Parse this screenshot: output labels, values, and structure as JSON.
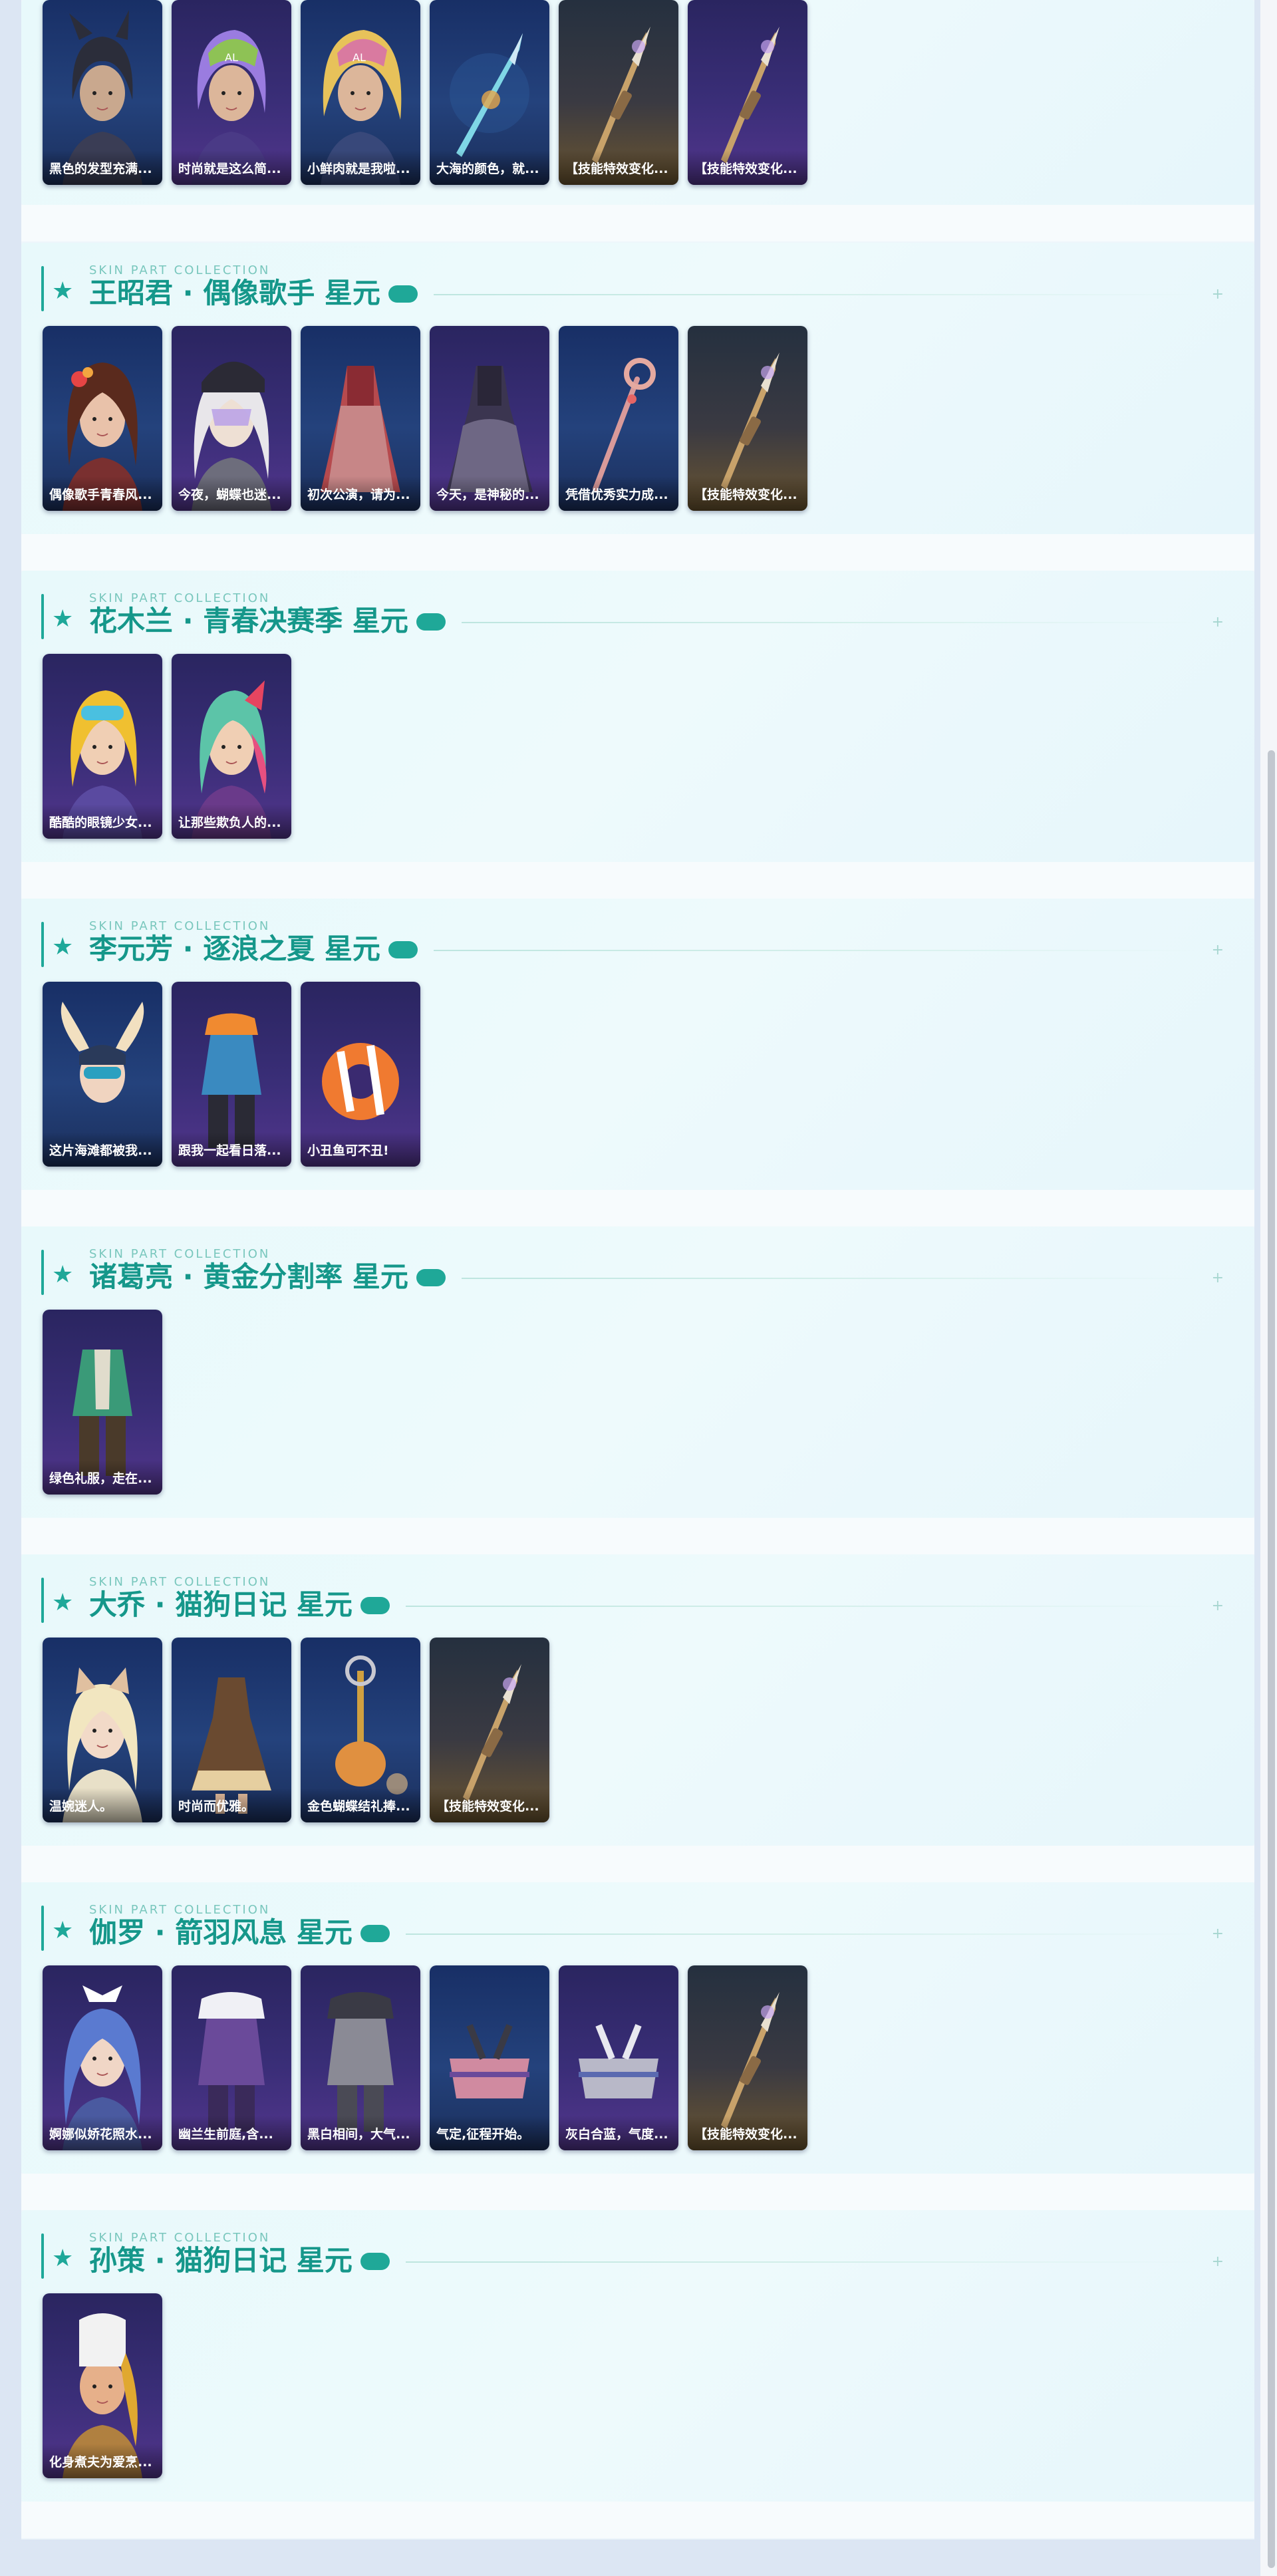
{
  "colors": {
    "accent": "#1ea899",
    "page_bg": "#dce6f3",
    "section_bg": "#e8f9fb",
    "card_blue": "#1f3a75",
    "card_purple": "#34296e",
    "card_gold": "#6b5530"
  },
  "top_row": {
    "items": [
      {
        "caption": "黑色的发型充满...",
        "tone": "blue",
        "icon": "hair-dark-icon"
      },
      {
        "caption": "时尚就是这么简...",
        "tone": "purple",
        "icon": "hair-purple-cap-icon"
      },
      {
        "caption": "小鲜肉就是我啦...",
        "tone": "blue",
        "icon": "hair-yellow-cap-icon"
      },
      {
        "caption": "大海的颜色，就...",
        "tone": "blue",
        "icon": "spear-icon"
      },
      {
        "caption": "【技能特效变化...",
        "tone": "gold",
        "icon": "weapon-effect-icon"
      },
      {
        "caption": "【技能特效变化...",
        "tone": "purple",
        "icon": "weapon-effect-icon"
      }
    ]
  },
  "sections": [
    {
      "subtitle": "SKIN PART COLLECTION",
      "title": "王昭君 · 偶像歌手 星元",
      "items": [
        {
          "caption": "偶像歌手青春风...",
          "tone": "blue",
          "icon": "hair-brown-icon"
        },
        {
          "caption": "今夜，蝴蝶也迷...",
          "tone": "purple",
          "icon": "hair-white-hat-icon"
        },
        {
          "caption": "初次公演，请为...",
          "tone": "blue",
          "icon": "dress-red-icon"
        },
        {
          "caption": "今天，是神秘的...",
          "tone": "purple",
          "icon": "dress-dark-icon"
        },
        {
          "caption": "凭借优秀实力成...",
          "tone": "blue",
          "icon": "staff-icon"
        },
        {
          "caption": "【技能特效变化...",
          "tone": "gold",
          "icon": "weapon-effect-icon"
        }
      ]
    },
    {
      "subtitle": "SKIN PART COLLECTION",
      "title": "花木兰 · 青春决赛季 星元",
      "items": [
        {
          "caption": "酷酷的眼镜少女...",
          "tone": "purple",
          "icon": "hair-yellow-goggles-icon"
        },
        {
          "caption": "让那些欺负人的...",
          "tone": "purple",
          "icon": "hair-pink-icon"
        }
      ]
    },
    {
      "subtitle": "SKIN PART COLLECTION",
      "title": "李元芳 · 逐浪之夏 星元",
      "items": [
        {
          "caption": "这片海滩都被我...",
          "tone": "blue",
          "icon": "winged-hat-icon"
        },
        {
          "caption": "跟我一起看日落...",
          "tone": "purple",
          "icon": "outfit-orange-icon"
        },
        {
          "caption": "小丑鱼可不丑!",
          "tone": "purple",
          "icon": "float-ring-icon"
        }
      ]
    },
    {
      "subtitle": "SKIN PART COLLECTION",
      "title": "诸葛亮 · 黄金分割率 星元",
      "items": [
        {
          "caption": "绿色礼服，走在...",
          "tone": "purple",
          "icon": "green-suit-icon"
        }
      ]
    },
    {
      "subtitle": "SKIN PART COLLECTION",
      "title": "大乔 · 猫狗日记 星元",
      "items": [
        {
          "caption": "温婉迷人。",
          "tone": "blue",
          "icon": "hair-blonde-cat-ears-icon"
        },
        {
          "caption": "时尚而优雅。",
          "tone": "blue",
          "icon": "dress-brown-icon"
        },
        {
          "caption": "金色蝴蝶结礼捧...",
          "tone": "blue",
          "icon": "scepter-cat-icon"
        },
        {
          "caption": "【技能特效变化...",
          "tone": "gold",
          "icon": "weapon-effect-icon"
        }
      ]
    },
    {
      "subtitle": "SKIN PART COLLECTION",
      "title": "伽罗 · 箭羽风息 星元",
      "items": [
        {
          "caption": "婀娜似娇花照水...",
          "tone": "purple",
          "icon": "hair-blue-bow-icon"
        },
        {
          "caption": "幽兰生前庭,含...",
          "tone": "purple",
          "icon": "outfit-white-fur-icon"
        },
        {
          "caption": "黑白相间，大气...",
          "tone": "purple",
          "icon": "outfit-grey-armor-icon"
        },
        {
          "caption": "气定,征程开始。",
          "tone": "blue",
          "icon": "bow-pink-icon"
        },
        {
          "caption": "灰白合蓝，气度...",
          "tone": "purple",
          "icon": "bow-grey-icon"
        },
        {
          "caption": "【技能特效变化...",
          "tone": "gold",
          "icon": "weapon-effect-icon"
        }
      ]
    },
    {
      "subtitle": "SKIN PART COLLECTION",
      "title": "孙策 · 猫狗日记 星元",
      "items": [
        {
          "caption": "化身煮夫为爱烹...",
          "tone": "purple",
          "icon": "chef-hat-icon"
        }
      ]
    }
  ]
}
